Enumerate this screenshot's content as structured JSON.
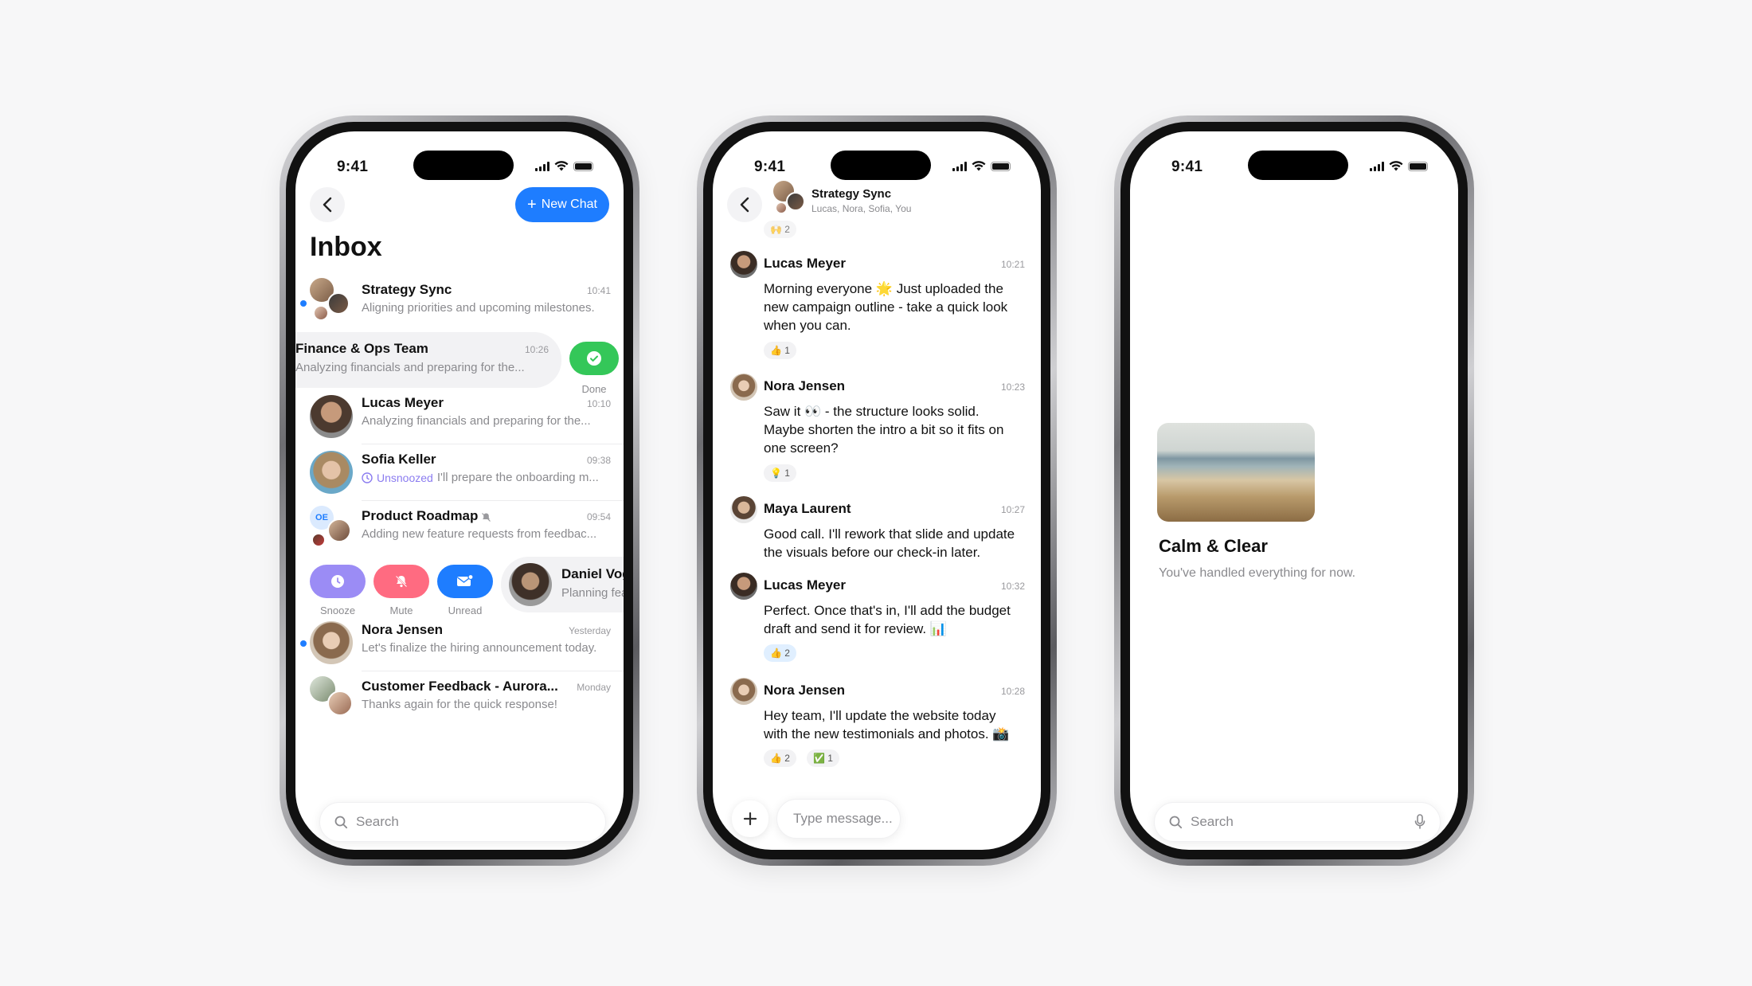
{
  "status": {
    "time": "9:41"
  },
  "inbox": {
    "title": "Inbox",
    "new_chat_label": "New Chat",
    "rows": [
      {
        "name": "Strategy Sync",
        "time": "10:41",
        "preview": "Aligning priorities and upcoming milestones."
      },
      {
        "name": "Finance & Ops Team",
        "time": "10:26",
        "preview": "Analyzing financials and preparing for the..."
      },
      {
        "name": "Lucas Meyer",
        "time": "10:10",
        "preview": "Analyzing financials and preparing for the..."
      },
      {
        "name": "Sofia Keller",
        "time": "09:38",
        "badge": "Unsnoozed",
        "preview": "I'll prepare the onboarding m..."
      },
      {
        "name": "Product Roadmap",
        "time": "09:54",
        "preview": "Adding new feature requests from feedbac...",
        "initials": "OE"
      },
      {
        "name": "Daniel Vog",
        "preview": "Planning fea"
      },
      {
        "name": "Nora Jensen",
        "time": "Yesterday",
        "preview": "Let's finalize the hiring announcement today."
      },
      {
        "name": "Customer Feedback - Aurora...",
        "time": "Monday",
        "preview": "Thanks again for the quick response!"
      }
    ],
    "done_label": "Done",
    "actions": {
      "snooze": "Snooze",
      "mute": "Mute",
      "unread": "Unread"
    },
    "search_placeholder": "Search"
  },
  "chat": {
    "title": "Strategy Sync",
    "subtitle": "Lucas, Nora, Sofia, You",
    "top_reaction": "🙌 2",
    "messages": [
      {
        "name": "Lucas Meyer",
        "time": "10:21",
        "text": "Morning everyone 🌟 Just uploaded the new campaign outline - take a quick look when you can.",
        "reactions": [
          "👍 1"
        ]
      },
      {
        "name": "Nora Jensen",
        "time": "10:23",
        "text": "Saw it 👀 - the structure looks solid. Maybe shorten the intro a bit so it fits on one screen?",
        "reactions": [
          "💡 1"
        ]
      },
      {
        "name": "Maya Laurent",
        "time": "10:27",
        "text": "Good call. I'll rework that slide and update the visuals before our check-in later.",
        "reactions": []
      },
      {
        "name": "Lucas Meyer",
        "time": "10:32",
        "text": "Perfect. Once that's in, I'll add the budget draft and send it for review. 📊",
        "reactions": [
          "👍 2"
        ]
      },
      {
        "name": "Nora Jensen",
        "time": "10:28",
        "text": "Hey team, I'll update the website today with the new testimonials and photos. 📸",
        "reactions": [
          "👍 2",
          "✅ 1"
        ]
      }
    ],
    "composer_placeholder": "Type message..."
  },
  "empty": {
    "title": "Calm & Clear",
    "subtitle": "You've handled everything for now.",
    "search_placeholder": "Search"
  },
  "colors": {
    "accent": "#1e7dff",
    "done": "#34c759",
    "snooze": "#9b8cf5",
    "mute": "#ff6b81",
    "unread": "#1e7dff"
  }
}
